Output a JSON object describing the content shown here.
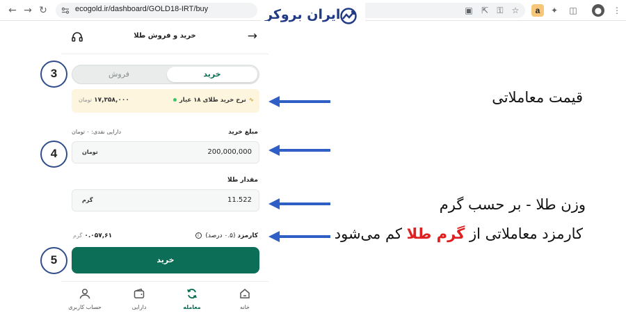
{
  "browser": {
    "url": "ecogold.ir/dashboard/GOLD18-IRT/buy",
    "extension_letter": "a"
  },
  "brand": {
    "name": "ایران بروکر",
    "color": "#213a84"
  },
  "app": {
    "header": {
      "title": "خرید و فروش طلا"
    },
    "tabs": {
      "buy": "خرید",
      "sell": "فروش"
    },
    "price": {
      "label": "نرخ خرید طلای ۱۸ عیار",
      "value": "۱۷,۳۵۸,۰۰۰",
      "unit": "تومان"
    },
    "amount": {
      "label": "مبلغ خرید",
      "balance": "دارایی نقدی: ۰ تومان",
      "value": "200,000,000",
      "unit": "تومان"
    },
    "gold": {
      "label": "مقدار طلا",
      "value": "11.522",
      "unit": "گرم"
    },
    "fee": {
      "label": "کارمزد",
      "percent": "(۰.۵ درصد)",
      "value": "۰.۰۵۷,۶۱",
      "unit": "گرم"
    },
    "buy_button": "خرید",
    "nav": [
      {
        "label": "خانه",
        "icon": "home-icon"
      },
      {
        "label": "معامله",
        "icon": "exchange-icon"
      },
      {
        "label": "دارایی",
        "icon": "wallet-icon"
      },
      {
        "label": "حساب کاربری",
        "icon": "user-icon"
      }
    ],
    "accent": "#0c6e56"
  },
  "steps": [
    "3",
    "4",
    "5"
  ],
  "annotations": {
    "price": "قیمت معاملاتی",
    "weight": "وزن طلا - بر حسب گرم",
    "fee_prefix": "کارمزد معاملاتی از",
    "fee_highlight": "گرم طلا",
    "fee_suffix": "کم می‌شود",
    "highlight_color": "#e02020",
    "arrow_color": "#2f5fc4"
  }
}
